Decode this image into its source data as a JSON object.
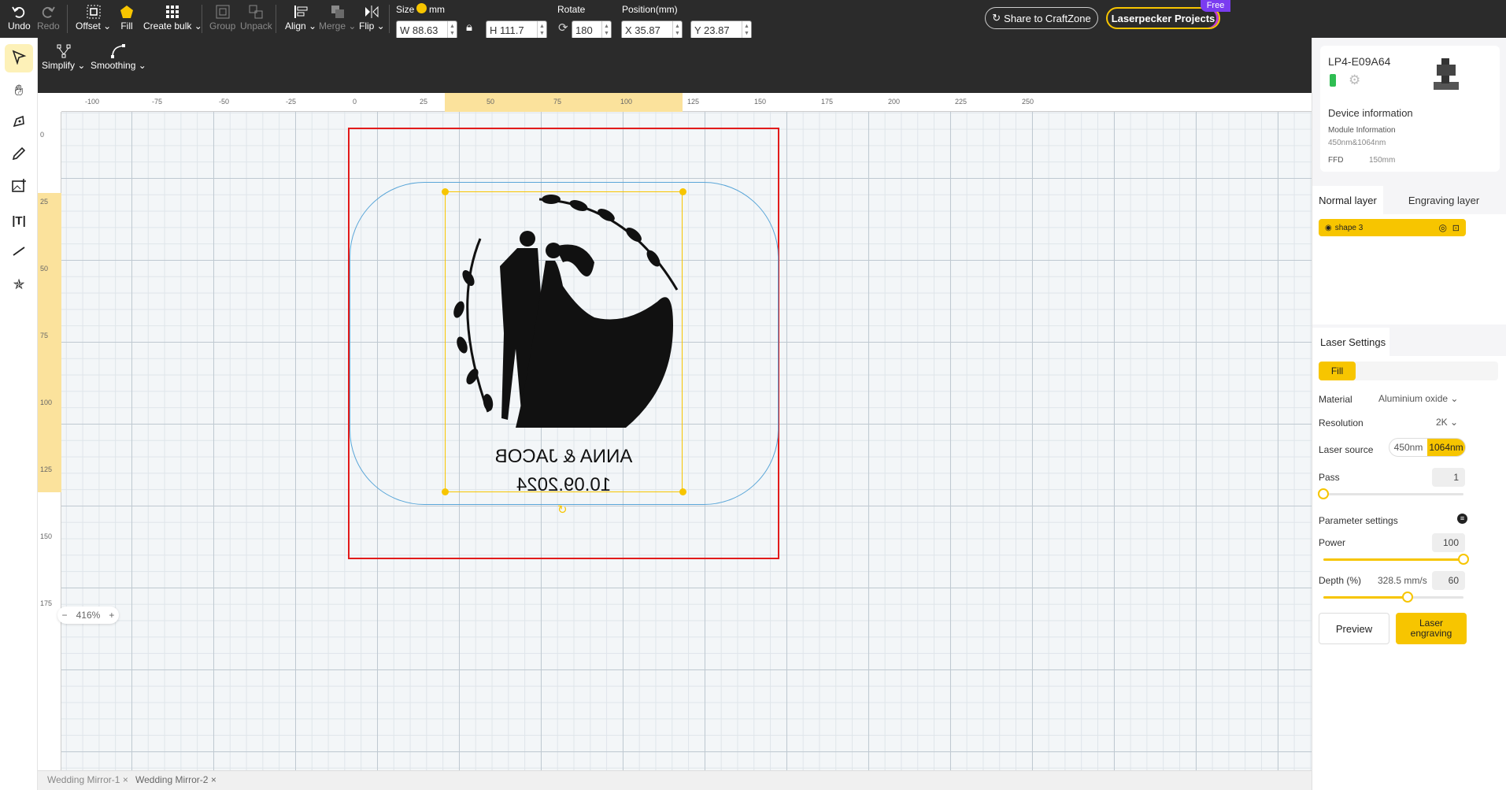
{
  "toolbar": {
    "undo": "Undo",
    "redo": "Redo",
    "offset": "Offset",
    "fill": "Fill",
    "create_bulk": "Create bulk",
    "group": "Group",
    "unpack": "Unpack",
    "align": "Align",
    "merge": "Merge",
    "flip": "Flip",
    "size_label": "Size",
    "unit": "mm",
    "w_value": "W 88.63",
    "h_value": "H 111.7",
    "rotate_label": "Rotate",
    "rotate_value": "180",
    "position_label": "Position(mm)",
    "x_value": "X 35.87",
    "y_value": "Y 23.87",
    "share_btn": "Share to CraftZone",
    "projects_btn": "Laserpecker Projects",
    "free_badge": "Free"
  },
  "subtoolbar": {
    "simplify": "Simplify",
    "smoothing": "Smoothing"
  },
  "ruler": {
    "h_ticks": [
      "-100",
      "-75",
      "-50",
      "-25",
      "0",
      "25",
      "50",
      "75",
      "100",
      "125",
      "150",
      "175",
      "200",
      "225",
      "250"
    ],
    "v_ticks": [
      "0",
      "25",
      "50",
      "75",
      "100",
      "125",
      "150",
      "175"
    ]
  },
  "canvas": {
    "line1": "ANNA & JACOB",
    "line2": "10.09.2024"
  },
  "zoom": {
    "value": "416%",
    "minus": "−",
    "plus": "+"
  },
  "file_tabs": [
    {
      "label": "Wedding Mirror-1",
      "close": "×"
    },
    {
      "label": "Wedding Mirror-2",
      "close": "×"
    }
  ],
  "device": {
    "name": "LP4-E09A64",
    "info_title": "Device information",
    "module_label": "Module Information",
    "module_value": "450nm&1064nm",
    "ffd_label": "FFD",
    "ffd_value": "150mm"
  },
  "layers": {
    "normal": "Normal layer",
    "engraving": "Engraving layer",
    "item": "shape 3"
  },
  "laser": {
    "title": "Laser Settings",
    "mode": "Fill",
    "material_label": "Material",
    "material_value": "Aluminium oxide",
    "resolution_label": "Resolution",
    "resolution_value": "2K",
    "source_label": "Laser source",
    "source_opt1": "450nm",
    "source_opt2": "1064nm",
    "pass_label": "Pass",
    "pass_value": "1",
    "params_title": "Parameter settings",
    "power_label": "Power",
    "power_value": "100",
    "power_fraction": 1.0,
    "depth_label": "Depth (%)",
    "depth_speed": "328.5 mm/s",
    "depth_value": "60",
    "depth_fraction": 0.6,
    "pass_fraction": 0.0,
    "preview": "Preview",
    "engrave": "Laser engraving"
  },
  "colors": {
    "accent": "#f7c500",
    "topbar": "#2b2b2b",
    "selection_red": "#e21b1b",
    "mirror_outline": "#5aa6d8"
  }
}
